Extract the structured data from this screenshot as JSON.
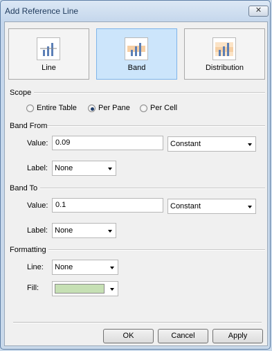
{
  "window": {
    "title": "Add Reference Line",
    "close_label": "✕"
  },
  "types": [
    {
      "label": "Line",
      "selected": false
    },
    {
      "label": "Band",
      "selected": true
    },
    {
      "label": "Distribution",
      "selected": false
    }
  ],
  "scope": {
    "heading": "Scope",
    "options": [
      {
        "label": "Entire Table",
        "selected": false
      },
      {
        "label": "Per Pane",
        "selected": true
      },
      {
        "label": "Per Cell",
        "selected": false
      }
    ]
  },
  "band_from": {
    "heading": "Band From",
    "value_label": "Value:",
    "value": "0.09",
    "value_type": "Constant",
    "label_label": "Label:",
    "label_value": "None"
  },
  "band_to": {
    "heading": "Band To",
    "value_label": "Value:",
    "value": "0.1",
    "value_type": "Constant",
    "label_label": "Label:",
    "label_value": "None"
  },
  "formatting": {
    "heading": "Formatting",
    "line_label": "Line:",
    "line_value": "None",
    "fill_label": "Fill:",
    "fill_color": "#c6e0b4"
  },
  "buttons": {
    "ok": "OK",
    "cancel": "Cancel",
    "apply": "Apply"
  },
  "colors": {
    "selected_tile": "#cce5fb",
    "band_fill": "#f6cfa4",
    "bar": "#5b7fb6"
  }
}
